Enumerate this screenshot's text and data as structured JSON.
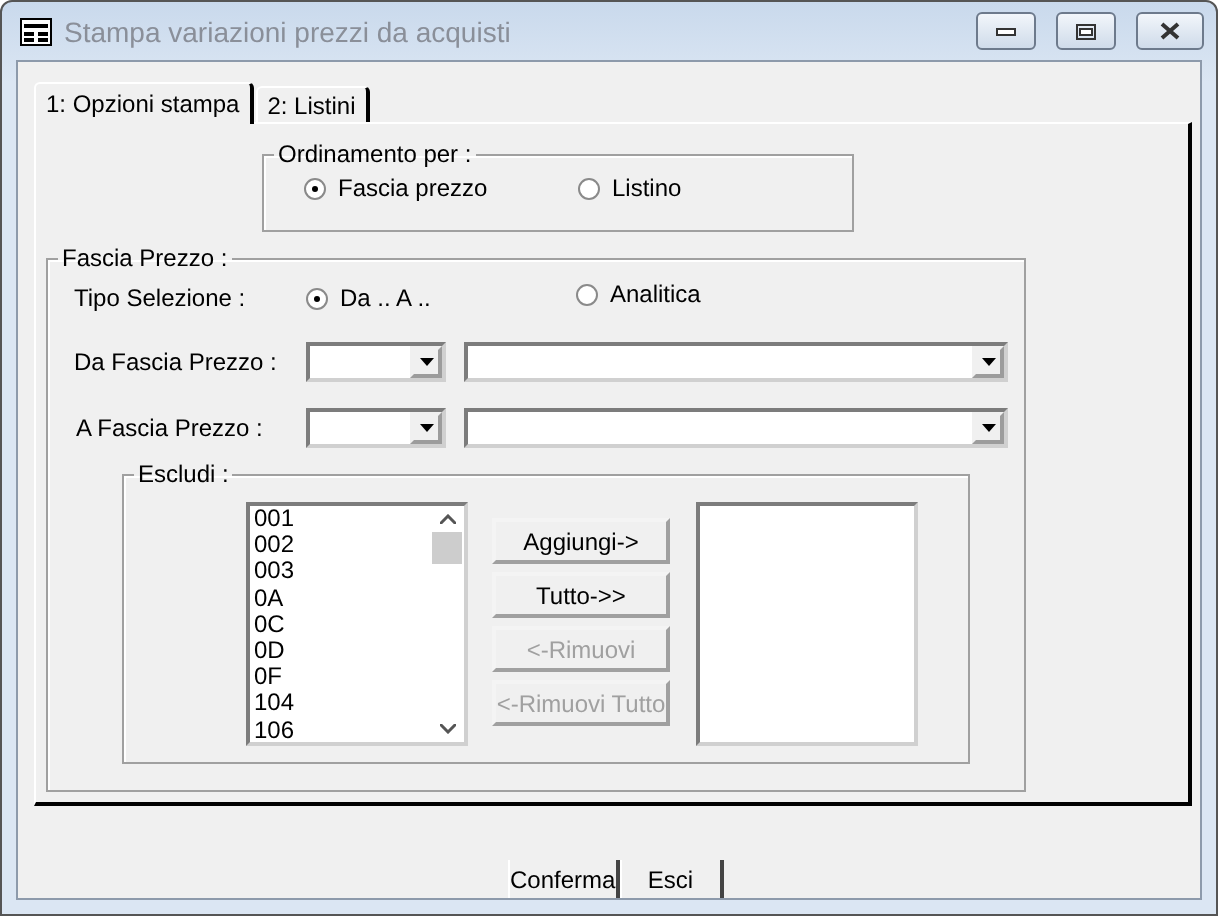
{
  "window": {
    "title": "Stampa variazioni prezzi da acquisti"
  },
  "tabs": [
    {
      "label": "1: Opzioni stampa",
      "selected": true
    },
    {
      "label": "2: Listini",
      "selected": false
    }
  ],
  "ordinamento": {
    "legend": "Ordinamento per :",
    "options": [
      {
        "label": "Fascia prezzo",
        "selected": true
      },
      {
        "label": "Listino",
        "selected": false
      }
    ]
  },
  "fascia_prezzo": {
    "legend": "Fascia Prezzo :",
    "tipo_selezione": {
      "label": "Tipo Selezione :",
      "options": [
        {
          "label": "Da .. A ..",
          "selected": true
        },
        {
          "label": "Analitica",
          "selected": false
        }
      ]
    },
    "ranges": [
      {
        "label": "Da Fascia Prezzo :"
      },
      {
        "label": "A Fascia Prezzo :"
      }
    ],
    "escludi": {
      "legend": "Escludi :",
      "available": [
        "001",
        "002",
        "003",
        "0A",
        "0C",
        "0D",
        "0F",
        "104",
        "106"
      ],
      "buttons": [
        {
          "label": "Aggiungi->",
          "disabled": false
        },
        {
          "label": "Tutto->>",
          "disabled": false
        },
        {
          "label": "<-Rimuovi",
          "disabled": true
        },
        {
          "label": "<-Rimuovi Tutto",
          "disabled": true
        }
      ]
    }
  },
  "buttons": [
    "Conferma",
    "Esci"
  ]
}
